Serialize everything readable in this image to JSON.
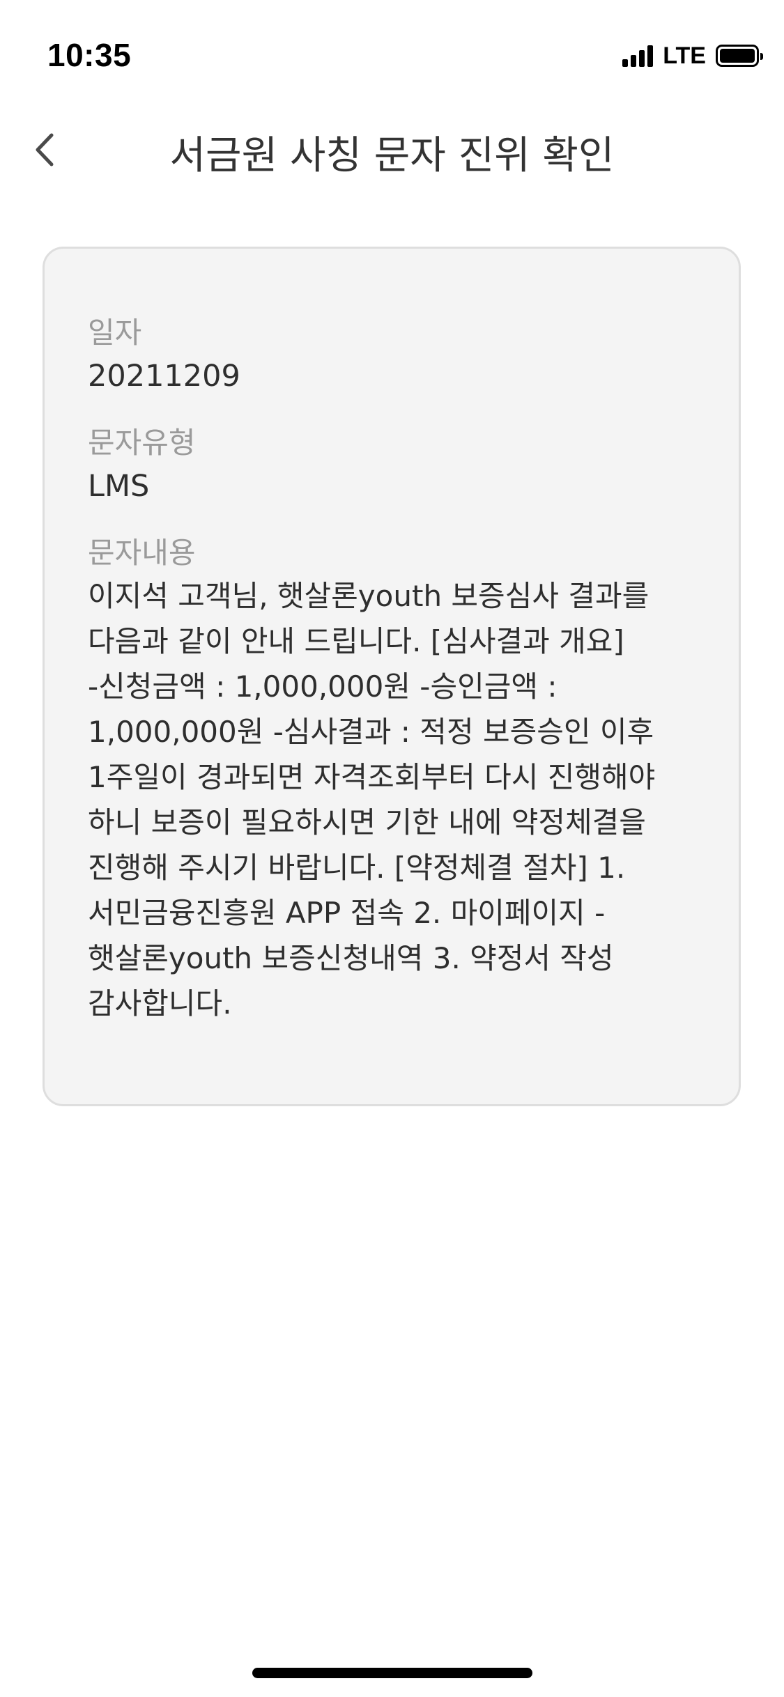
{
  "status_bar": {
    "time": "10:35",
    "network": "LTE",
    "icons": [
      "signal-icon",
      "battery-icon"
    ]
  },
  "header": {
    "title": "서금원 사칭 문자 진위 확인",
    "back_icon": "chevron-left-icon"
  },
  "card": {
    "date": {
      "label": "일자",
      "value": "20211209"
    },
    "type": {
      "label": "문자유형",
      "value": "LMS"
    },
    "content": {
      "label": "문자내용",
      "value": "이지석 고객님, 햇살론youth 보증심사 결과를\n다음과 같이 안내 드립니다. [심사결과 개요]\n-신청금액 : 1,000,000원 -승인금액 :\n1,000,000원 -심사결과 : 적정 보증승인 이후\n1주일이 경과되면 자격조회부터 다시 진행해야\n하니 보증이 필요하시면 기한 내에 약정체결을\n진행해 주시기 바랍니다. [약정체결 절차] 1.\n서민금융진흥원 APP 접속 2. 마이페이지 -\n햇살론youth 보증신청내역 3. 약정서 작성\n감사합니다."
    }
  }
}
